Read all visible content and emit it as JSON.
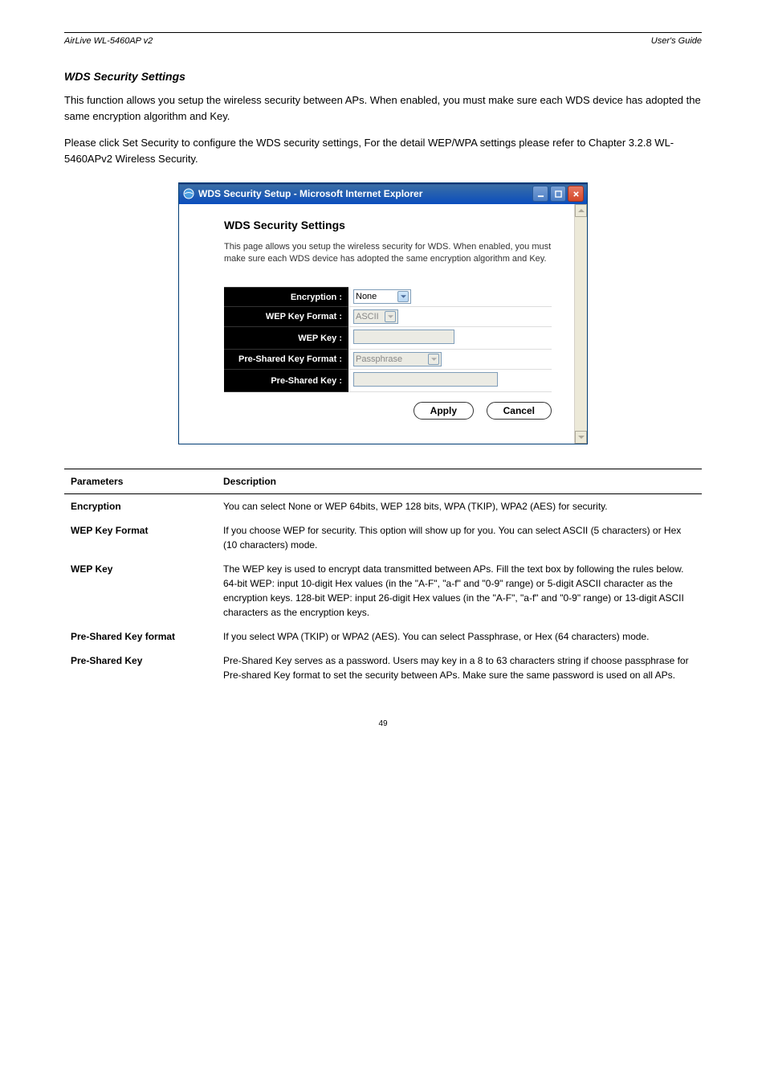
{
  "header": {
    "product": "AirLive WL-5460AP v2",
    "doc": "User's Guide"
  },
  "section": {
    "title": "WDS Security Settings",
    "intro": "This function allows you setup the wireless security between APs. When enabled, you must make sure each WDS device has adopted the same encryption algorithm and Key.",
    "note": "Please click Set Security to configure the WDS security settings, For the detail WEP/WPA settings please refer to Chapter 3.2.8 WL-5460APv2 Wireless Security."
  },
  "window": {
    "title": "WDS Security Setup - Microsoft Internet Explorer",
    "panel_title": "WDS Security Settings",
    "panel_desc": "This page allows you setup the wireless security for WDS. When enabled, you must make sure each WDS device has adopted the same encryption algorithm and Key.",
    "fields": {
      "encryption_label": "Encryption :",
      "encryption_value": "None",
      "wep_format_label": "WEP Key Format :",
      "wep_format_value": "ASCII",
      "wep_key_label": "WEP Key :",
      "psk_format_label": "Pre-Shared Key Format :",
      "psk_format_value": "Passphrase",
      "psk_label": "Pre-Shared Key :"
    },
    "buttons": {
      "apply": "Apply",
      "cancel": "Cancel"
    }
  },
  "table": {
    "h1": "Parameters",
    "h2": "Description",
    "rows": [
      {
        "param": "Encryption",
        "desc": "You can select None or WEP 64bits, WEP 128 bits, WPA (TKIP), WPA2 (AES) for security."
      },
      {
        "param": "WEP Key Format",
        "desc": "If you choose WEP for security. This option will show up for you. You can select ASCII (5 characters) or Hex (10 characters) mode."
      },
      {
        "param": "WEP Key",
        "desc": "The WEP key is used to encrypt data transmitted between APs. Fill the text box by following the rules below. 64-bit WEP: input 10-digit Hex values (in the \"A-F\", \"a-f\" and \"0-9\" range) or 5-digit ASCII character as the encryption keys. 128-bit WEP: input 26-digit Hex values (in the \"A-F\", \"a-f\" and \"0-9\" range) or 13-digit ASCII characters as the encryption keys."
      },
      {
        "param": "Pre-Shared Key format",
        "desc": "If you select WPA (TKIP) or WPA2 (AES). You can select Passphrase, or Hex (64 characters) mode."
      },
      {
        "param": "Pre-Shared Key",
        "desc": "Pre-Shared Key serves as a password. Users may key in a 8 to 63 characters string if choose passphrase for Pre-shared Key format to set the security between APs. Make sure the same password is used on all APs."
      }
    ]
  },
  "footer": "49"
}
